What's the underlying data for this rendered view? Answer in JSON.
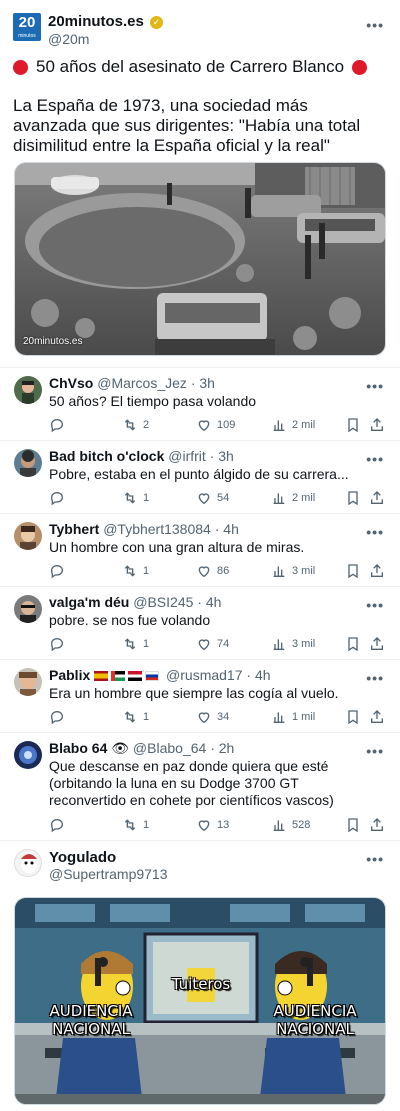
{
  "post": {
    "logo_number": "20",
    "logo_word": "minutos",
    "name": "20minutos.es",
    "handle": "@20m",
    "headline": "50 años del asesinato de Carrero Blanco",
    "lead": "La España de 1973, una sociedad más avanzada que sus dirigentes: \"Había una total disimilitud entre la España oficial y la real\"",
    "photo_label": "20minutos.es",
    "accent_color": "#e0182b"
  },
  "replies": [
    {
      "name": "ChVso",
      "handle": "@Marcos_Jez",
      "time": "3h",
      "text": "50 años? El tiempo pasa volando",
      "replies": "",
      "reposts": "2",
      "likes": "109",
      "views": "2 mil"
    },
    {
      "name": "Bad bitch o'clock",
      "handle": "@irfrit",
      "time": "3h",
      "text": "Pobre, estaba en el punto álgido de su carrera...",
      "replies": "",
      "reposts": "1",
      "likes": "54",
      "views": "2 mil"
    },
    {
      "name": "Tybhert",
      "handle": "@Tybhert138084",
      "time": "4h",
      "text": "Un hombre con una gran altura de miras.",
      "replies": "",
      "reposts": "1",
      "likes": "86",
      "views": "3 mil"
    },
    {
      "name": "valga'm déu",
      "handle": "@BSI245",
      "time": "4h",
      "text": "pobre. se nos fue volando",
      "replies": "",
      "reposts": "1",
      "likes": "74",
      "views": "3 mil"
    },
    {
      "name": "Pablix",
      "handle": "@rusmad17",
      "time": "4h",
      "text": "Era un hombre que siempre las cogía al vuelo.",
      "replies": "",
      "reposts": "1",
      "likes": "34",
      "views": "1 mil"
    },
    {
      "name": "Blabo 64",
      "handle": "@Blabo_64",
      "time": "2h",
      "text": "Que descanse en paz donde quiera que esté (orbitando la luna en su Dodge 3700 GT reconvertido en cohete por científicos vascos)",
      "replies": "",
      "reposts": "1",
      "likes": "13",
      "views": "528"
    }
  ],
  "last_reply": {
    "name": "Yogulado",
    "handle": "@Supertramp9713",
    "meme_left": "AUDIENCIA NACIONAL",
    "meme_center": "Tuiteros",
    "meme_right": "AUDIENCIA NACIONAL"
  },
  "more_glyph": "•••",
  "separator": "·"
}
